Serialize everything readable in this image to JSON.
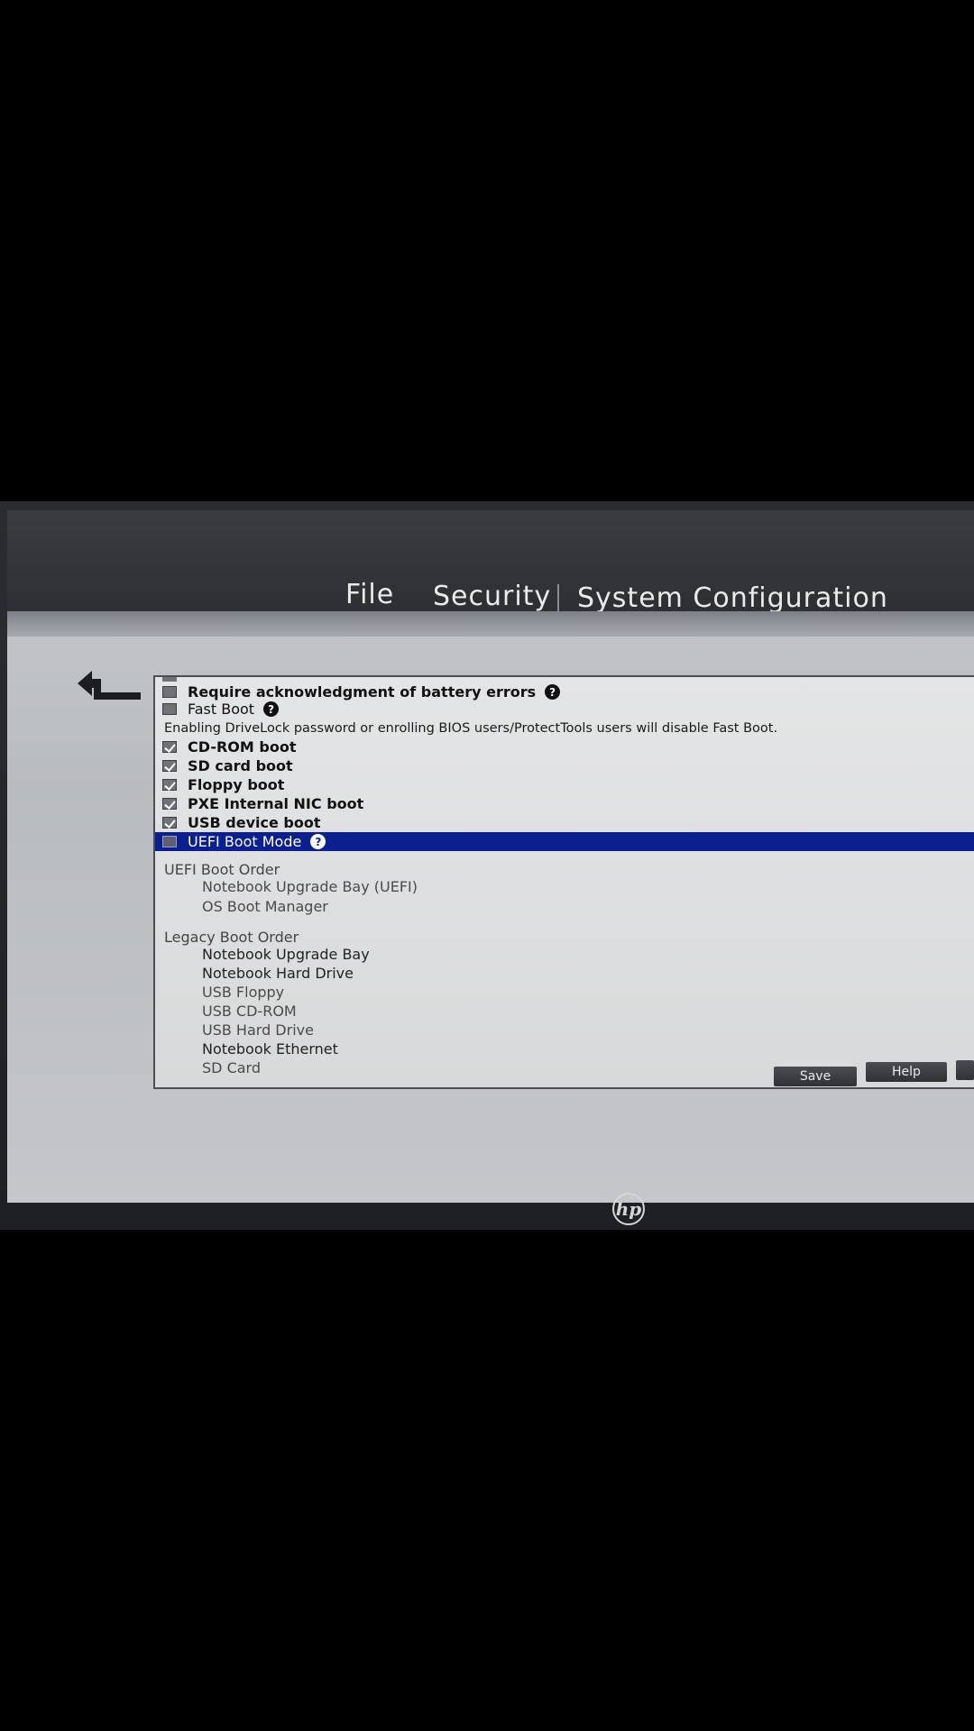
{
  "menu": {
    "file": "File",
    "security": "Security",
    "system_configuration": "System Configuration"
  },
  "boot_options": [
    {
      "label": "Require acknowledgment of battery errors",
      "checked": false,
      "help": true,
      "bold": true
    },
    {
      "label": "Fast Boot",
      "checked": false,
      "help": true,
      "bold": false
    },
    {
      "label": "CD-ROM boot",
      "checked": true,
      "help": false,
      "bold": true
    },
    {
      "label": "SD card boot",
      "checked": true,
      "help": false,
      "bold": true
    },
    {
      "label": "Floppy boot",
      "checked": true,
      "help": false,
      "bold": true
    },
    {
      "label": "PXE Internal NIC boot",
      "checked": true,
      "help": false,
      "bold": true
    },
    {
      "label": "USB device boot",
      "checked": true,
      "help": false,
      "bold": true
    },
    {
      "label": "UEFI Boot Mode",
      "checked": false,
      "help": true,
      "bold": false,
      "selected": true
    }
  ],
  "fast_boot_note": "Enabling DriveLock password or enrolling BIOS users/ProtectTools users will disable Fast Boot.",
  "uefi_boot_order": {
    "title": "UEFI Boot Order",
    "items": [
      "Notebook Upgrade Bay (UEFI)",
      "OS Boot Manager"
    ]
  },
  "legacy_boot_order": {
    "title": "Legacy Boot Order",
    "items": [
      "Notebook Upgrade Bay",
      "Notebook Hard Drive",
      "USB Floppy",
      "USB CD-ROM",
      "USB Hard Drive",
      "Notebook Ethernet",
      "SD Card"
    ]
  },
  "buttons": {
    "save": "Save",
    "help": "Help"
  },
  "help_icon_glyph": "?",
  "logo_text": "hp",
  "icons": {
    "back": "back-arrow-icon",
    "help": "question-circle-icon",
    "checkbox": "checkbox-icon",
    "logo": "hp-logo"
  },
  "colors": {
    "selection": "#0c1f8f",
    "menubar": "#2d2f33"
  }
}
